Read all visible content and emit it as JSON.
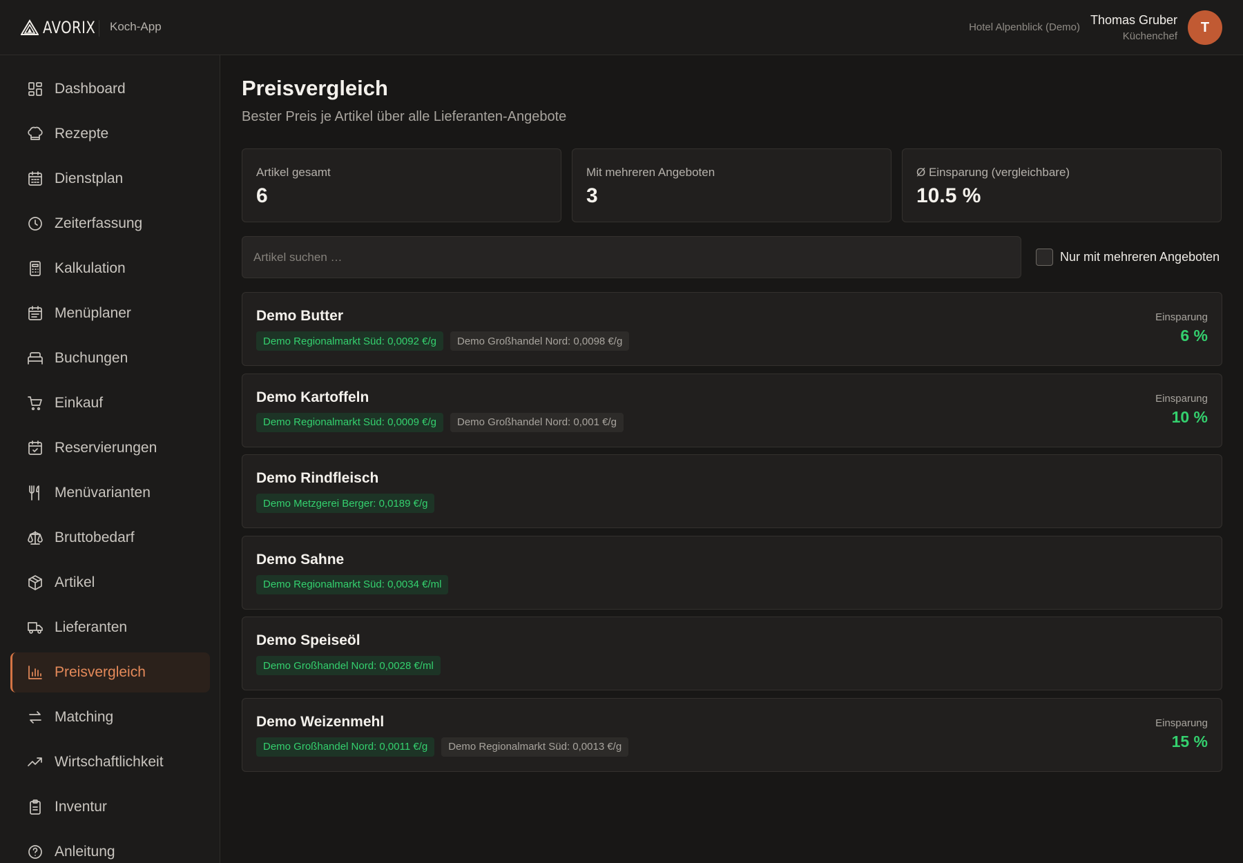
{
  "header": {
    "logo_text": "AVORIX",
    "app_name": "Koch-App",
    "hotel": "Hotel Alpenblick (Demo)",
    "user_name": "Thomas Gruber",
    "user_role": "Küchenchef",
    "avatar_initial": "T"
  },
  "sidebar": {
    "items": [
      {
        "label": "Dashboard",
        "icon": "dashboard-icon"
      },
      {
        "label": "Rezepte",
        "icon": "chef-hat-icon"
      },
      {
        "label": "Dienstplan",
        "icon": "calendar-grid-icon"
      },
      {
        "label": "Zeiterfassung",
        "icon": "clock-icon"
      },
      {
        "label": "Kalkulation",
        "icon": "calculator-icon"
      },
      {
        "label": "Menüplaner",
        "icon": "calendar-list-icon"
      },
      {
        "label": "Buchungen",
        "icon": "bed-icon"
      },
      {
        "label": "Einkauf",
        "icon": "cart-icon"
      },
      {
        "label": "Reservierungen",
        "icon": "calendar-check-icon"
      },
      {
        "label": "Menüvarianten",
        "icon": "utensils-icon"
      },
      {
        "label": "Bruttobedarf",
        "icon": "scale-icon"
      },
      {
        "label": "Artikel",
        "icon": "package-icon"
      },
      {
        "label": "Lieferanten",
        "icon": "truck-icon"
      },
      {
        "label": "Preisvergleich",
        "icon": "bar-chart-icon",
        "active": true
      },
      {
        "label": "Matching",
        "icon": "arrows-swap-icon"
      },
      {
        "label": "Wirtschaftlichkeit",
        "icon": "trending-up-icon"
      },
      {
        "label": "Inventur",
        "icon": "clipboard-icon"
      },
      {
        "label": "Anleitung",
        "icon": "help-circle-icon"
      }
    ]
  },
  "main": {
    "title": "Preisvergleich",
    "subtitle": "Bester Preis je Artikel über alle Lieferanten-Angebote",
    "stats": [
      {
        "label": "Artikel gesamt",
        "value": "6"
      },
      {
        "label": "Mit mehreren Angeboten",
        "value": "3"
      },
      {
        "label": "Ø Einsparung (vergleichbare)",
        "value": "10.5 %"
      }
    ],
    "search_placeholder": "Artikel suchen …",
    "search_value": "",
    "filter_label": "Nur mit mehreren Angeboten",
    "filter_checked": false,
    "savings_label": "Einsparung",
    "articles": [
      {
        "name": "Demo Butter",
        "best": "Demo Regionalmarkt Süd: 0,0092 €/g",
        "others": [
          "Demo Großhandel Nord: 0,0098 €/g"
        ],
        "savings": "6 %"
      },
      {
        "name": "Demo Kartoffeln",
        "best": "Demo Regionalmarkt Süd: 0,0009 €/g",
        "others": [
          "Demo Großhandel Nord: 0,001 €/g"
        ],
        "savings": "10 %"
      },
      {
        "name": "Demo Rindfleisch",
        "best": "Demo Metzgerei Berger: 0,0189 €/g",
        "others": [],
        "savings": ""
      },
      {
        "name": "Demo Sahne",
        "best": "Demo Regionalmarkt Süd: 0,0034 €/ml",
        "others": [],
        "savings": ""
      },
      {
        "name": "Demo Speiseöl",
        "best": "Demo Großhandel Nord: 0,0028 €/ml",
        "others": [],
        "savings": ""
      },
      {
        "name": "Demo Weizenmehl",
        "best": "Demo Großhandel Nord: 0,0011 €/g",
        "others": [
          "Demo Regionalmarkt Süd: 0,0013 €/g"
        ],
        "savings": "15 %"
      }
    ]
  },
  "colors": {
    "accent": "#d47444",
    "best_price": "#34d06e",
    "avatar": "#c15a33"
  }
}
